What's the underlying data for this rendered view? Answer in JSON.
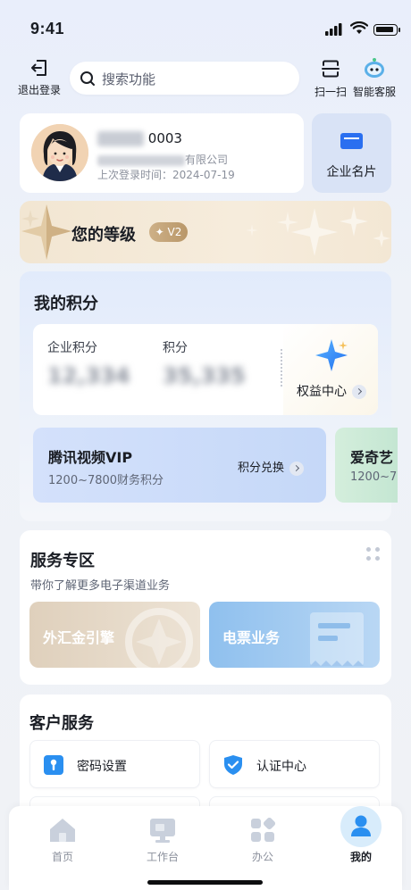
{
  "status": {
    "time": "9:41"
  },
  "topbar": {
    "logout_label": "退出登录",
    "search_placeholder": "搜索功能",
    "scan_label": "扫一扫",
    "cs_label": "智能客服"
  },
  "profile": {
    "name_suffix": "0003",
    "company_suffix": "有限公司",
    "last_login": "上次登录时间：2024-07-19"
  },
  "bizcard": {
    "label": "企业名片"
  },
  "level": {
    "title": "您的等级",
    "badge": "V2"
  },
  "points": {
    "title": "我的积分",
    "enterprise_label": "企业积分",
    "enterprise_value": "12,334",
    "personal_label": "积分",
    "personal_value": "35,335",
    "center_label": "权益中心",
    "offers": [
      {
        "name": "腾讯视频VIP",
        "desc": "1200~7800财务积分",
        "action": "积分兑换"
      },
      {
        "name": "爱奇艺",
        "desc": "1200~7"
      }
    ]
  },
  "service": {
    "title": "服务专区",
    "subtitle": "带你了解更多电子渠道业务",
    "items": [
      "外汇金引擎",
      "电票业务"
    ]
  },
  "customer": {
    "title": "客户服务",
    "items": [
      "密码设置",
      "认证中心"
    ]
  },
  "tabs": [
    {
      "label": "首页",
      "active": false
    },
    {
      "label": "工作台",
      "active": false
    },
    {
      "label": "办公",
      "active": false
    },
    {
      "label": "我的",
      "active": true
    }
  ],
  "colors": {
    "accent": "#2a6ff0",
    "gold": "#c3a375"
  }
}
